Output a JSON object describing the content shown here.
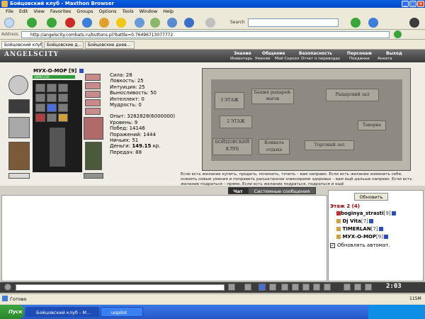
{
  "window": {
    "title": "Бойцовский клуб - Maxthon Browser"
  },
  "menu": [
    "File",
    "Edit",
    "View",
    "Favorites",
    "Groups",
    "Options",
    "Tools",
    "Window",
    "Help"
  ],
  "search": {
    "label": "Search"
  },
  "address": {
    "label": "Address",
    "url": "http://angelscity.combats.ru/buttons.pl?battle=0.76496713077772"
  },
  "tabs": [
    "Бойцовский клуб",
    "Бойцовские д...",
    "Бойцовские днев..."
  ],
  "game": {
    "logo": "ANGELSCITY",
    "top_menu": [
      "Знания",
      "Общение",
      "Безопасность",
      "Персонаж",
      "Выход"
    ],
    "sub_menu": [
      "Инвентарь",
      "Умения",
      "Мой Скроол",
      "Отчет о переводах",
      "Поединки",
      "Анкета"
    ],
    "character": {
      "name": "МУХ-О-МОР [9]",
      "hp": "1069/1230"
    },
    "stats": {
      "strength": "Сила: 28",
      "agility": "Ловкость: 25",
      "intuition": "Интуиция: 25",
      "endurance": "Выносливость: 50",
      "intellect": "Интеллект: 0",
      "wisdom": "Мудрость: 0",
      "exp": "Опыт: 3282828(6000000)",
      "level": "Уровень: 9",
      "wins": "Побед: 14146",
      "losses": "Поражений: 1444",
      "draws": "Ничьих: 51",
      "money_label": "Деньги:",
      "money_value": "149.15",
      "money_unit": "кр.",
      "transfers": "Передач: 88"
    },
    "map": {
      "rooms": {
        "floor3": "3 ЭТАЖ",
        "knights": "Башня рыцарей-магов",
        "knights_hall": "Рыцарский зал",
        "floor2": "2 ЭТАЖ",
        "tavern": "Таверна",
        "club": "БОЙЦОВСКИЙ КЛУБ",
        "rest": "Комната отдыха",
        "trade": "Торговый зал"
      },
      "description": "Если есть желание купить, продать, починить, точить – вам направо. Если есть желание изменить себя, освоить новые умения и поправить расшатанное эликсирами здоровье – вам ещё дальше направо. Если есть желание подраться – прямо. Если есть желание подраться, подраться и ещё"
    }
  },
  "chat": {
    "tab_chat": "Чат",
    "tab_system": "Системные сообщения"
  },
  "online": {
    "refresh": "Обновить",
    "floor": "Этаж 2 (4)",
    "players": [
      {
        "name": "boginya_strasti",
        "level": "[9]"
      },
      {
        "name": "Dj Vita",
        "level": "[7]"
      },
      {
        "name": "TIMERLAN",
        "level": "[7]"
      },
      {
        "name": "МУХ-О-МОР",
        "level": "[9]"
      }
    ],
    "auto_refresh": "Обновлять автомат."
  },
  "clock": "2:03",
  "status": {
    "text": "Готово",
    "right": "115M"
  },
  "taskbar": {
    "start": "Пуск",
    "tasks": [
      "Бойцовский клуб - M...",
      "uopilot"
    ]
  }
}
